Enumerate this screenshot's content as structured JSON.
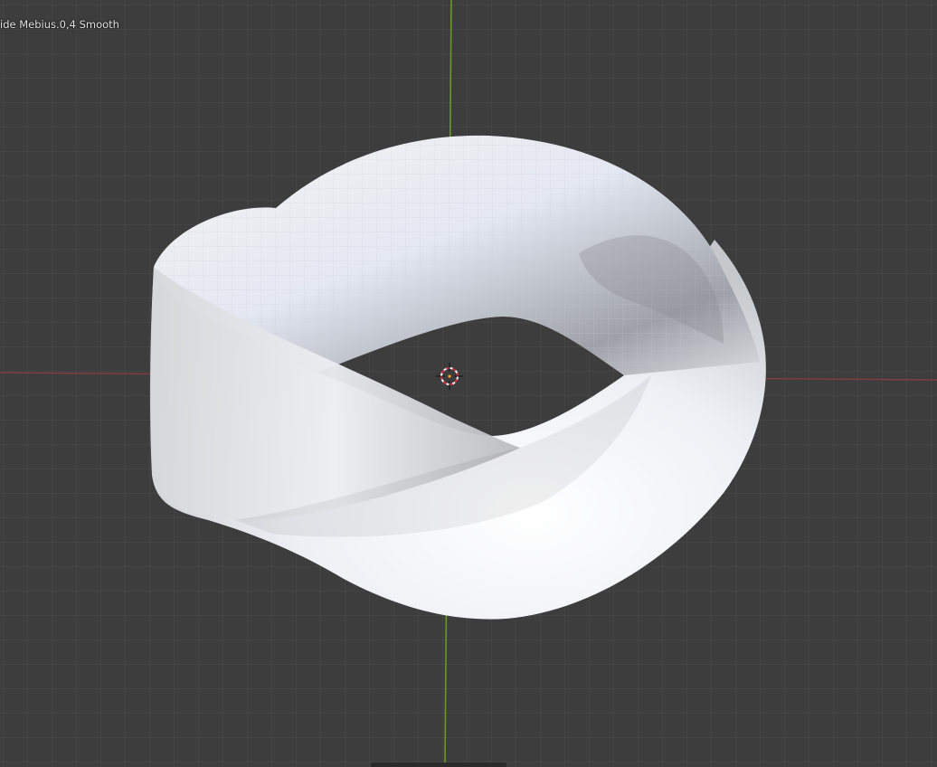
{
  "viewport": {
    "object_label": "ide Mebius.0,4 Smooth",
    "background_color": "#3d3d3d",
    "grid_color": "#505050",
    "x_axis_color": "#8c3a44",
    "y_axis_color": "#6b9a22",
    "object_color": "#e8eaee",
    "origin_icon": "3d-cursor-icon"
  }
}
